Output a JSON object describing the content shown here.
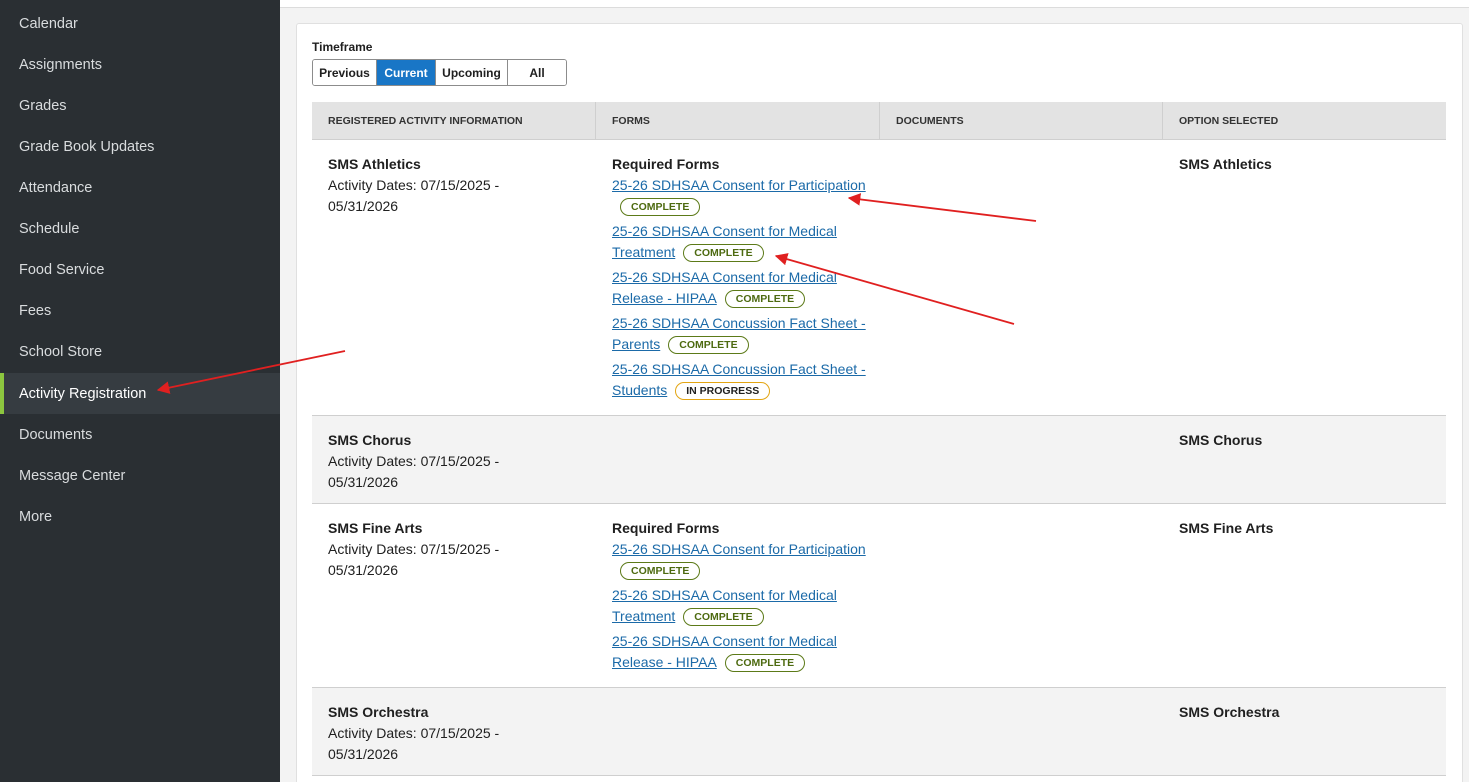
{
  "sidebar": {
    "items": [
      {
        "label": "Calendar"
      },
      {
        "label": "Assignments"
      },
      {
        "label": "Grades"
      },
      {
        "label": "Grade Book Updates"
      },
      {
        "label": "Attendance"
      },
      {
        "label": "Schedule"
      },
      {
        "label": "Food Service"
      },
      {
        "label": "Fees"
      },
      {
        "label": "School Store"
      },
      {
        "label": "Activity Registration"
      },
      {
        "label": "Documents"
      },
      {
        "label": "Message Center"
      },
      {
        "label": "More"
      }
    ],
    "active_item": "Activity Registration",
    "accent_color": "#8cc63f"
  },
  "timeframe": {
    "label": "Timeframe",
    "options": [
      "Previous",
      "Current",
      "Upcoming",
      "All"
    ],
    "selected": "Current"
  },
  "table": {
    "headers": [
      "REGISTERED ACTIVITY INFORMATION",
      "FORMS",
      "DOCUMENTS",
      "OPTION SELECTED"
    ],
    "rows": [
      {
        "activity": "SMS Athletics",
        "dates": "Activity Dates: 07/15/2025 - 05/31/2026",
        "forms_title": "Required Forms",
        "forms": [
          {
            "name": "25-26 SDHSAA Consent for Participation",
            "status": "COMPLETE"
          },
          {
            "name": "25-26 SDHSAA Consent for Medical Treatment",
            "status": "COMPLETE"
          },
          {
            "name": "25-26 SDHSAA Consent for Medical Release - HIPAA",
            "status": "COMPLETE"
          },
          {
            "name": "25-26 SDHSAA Concussion Fact Sheet - Parents",
            "status": "COMPLETE"
          },
          {
            "name": "25-26 SDHSAA Concussion Fact Sheet - Students",
            "status": "IN PROGRESS"
          }
        ],
        "option": "SMS Athletics"
      },
      {
        "activity": "SMS Chorus",
        "dates": "Activity Dates: 07/15/2025 - 05/31/2026",
        "option": "SMS Chorus"
      },
      {
        "activity": "SMS Fine Arts",
        "dates": "Activity Dates: 07/15/2025 - 05/31/2026",
        "forms_title": "Required Forms",
        "forms": [
          {
            "name": "25-26 SDHSAA Consent for Participation",
            "status": "COMPLETE"
          },
          {
            "name": "25-26 SDHSAA Consent for Medical Treatment",
            "status": "COMPLETE"
          },
          {
            "name": "25-26 SDHSAA Consent for Medical Release - HIPAA",
            "status": "COMPLETE"
          }
        ],
        "option": "SMS Fine Arts"
      },
      {
        "activity": "SMS Orchestra",
        "dates": "Activity Dates: 07/15/2025 - 05/31/2026",
        "option": "SMS Orchestra"
      }
    ]
  },
  "colors": {
    "sidebar_bg": "#2a2f33",
    "selected_button": "#1976c6",
    "link": "#1b6aa8",
    "complete_badge": "#5c7a18",
    "in_progress_badge": "#e3a512",
    "annotation_arrow": "#e02020"
  }
}
